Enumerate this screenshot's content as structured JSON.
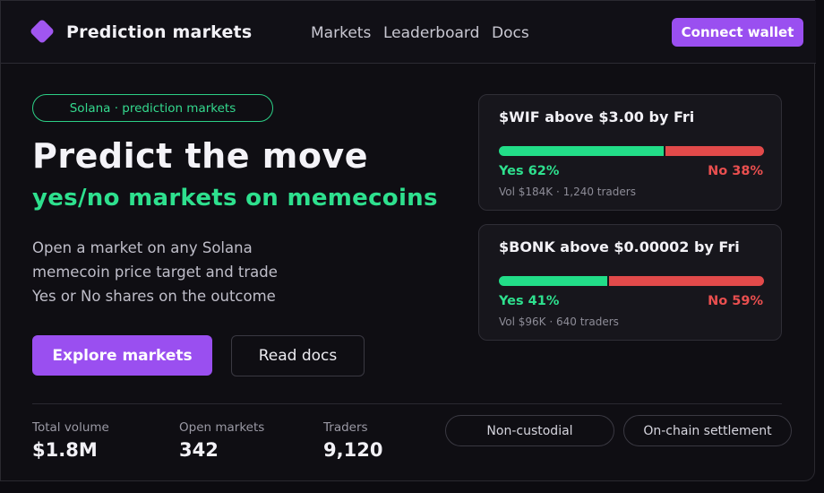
{
  "header": {
    "brand": "Prediction markets",
    "nav": [
      "Markets",
      "Leaderboard",
      "Docs"
    ],
    "connect_label": "Connect wallet"
  },
  "hero": {
    "tag": "Solana · prediction markets",
    "title": "Predict the move",
    "subtitle": "yes/no markets on memecoins",
    "description": [
      "Open a market on any Solana",
      "memecoin price target and trade",
      "Yes or No shares on the outcome"
    ],
    "primary_button": "Explore markets",
    "secondary_button": "Read docs"
  },
  "markets": [
    {
      "title": "$WIF above $3.00 by Fri",
      "yes_pct": 62,
      "no_pct": 38,
      "yes_label": "Yes 62%",
      "no_label": "No 38%",
      "meta": "Vol $184K · 1,240 traders"
    },
    {
      "title": "$BONK above $0.00002 by Fri",
      "yes_pct": 41,
      "no_pct": 59,
      "yes_label": "Yes 41%",
      "no_label": "No 59%",
      "meta": "Vol $96K · 640 traders"
    }
  ],
  "stats": [
    {
      "label": "Total volume",
      "value": "$1.8M"
    },
    {
      "label": "Open markets",
      "value": "342"
    },
    {
      "label": "Traders",
      "value": "9,120"
    }
  ],
  "badges": [
    "Non-custodial",
    "On-chain settlement"
  ],
  "colors": {
    "accent": "#9a4ff0",
    "yes": "#22dd88",
    "no": "#e24a4a",
    "background": "#0f0e13"
  },
  "icons": {
    "logo": "diamond-logo-icon"
  }
}
